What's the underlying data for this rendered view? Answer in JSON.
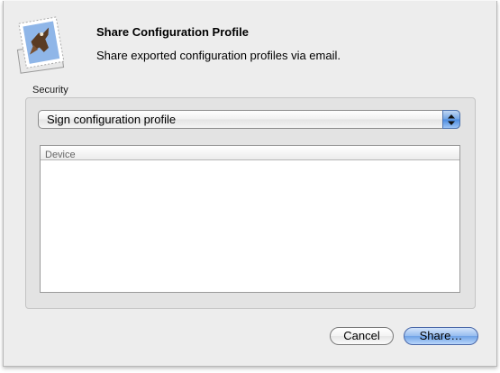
{
  "dialog": {
    "title": "Share Configuration Profile",
    "subtitle": "Share exported configuration profiles via email.",
    "app_icon": "mail-stamp-eagle-icon"
  },
  "security": {
    "label": "Security",
    "selected_option": "Sign configuration profile"
  },
  "device_table": {
    "columns": [
      "Device"
    ],
    "rows": []
  },
  "buttons": {
    "cancel_label": "Cancel",
    "share_label": "Share…"
  },
  "colors": {
    "default_button_accent": "#6fa2e6",
    "dialog_background": "#ededed"
  }
}
